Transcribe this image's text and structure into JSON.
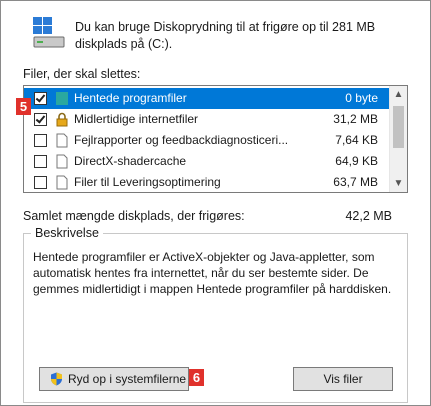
{
  "header": {
    "line1": "Du kan bruge Diskoprydning til at frigøre op til 281 MB",
    "line2": "diskplads på  (C:).",
    "icon": "disk-cleanup-icon"
  },
  "files_label": "Filer, der skal slettes:",
  "files": [
    {
      "name": "Hentede programfiler",
      "size": "0 byte",
      "checked": true,
      "selected": true,
      "icon": "folder-teal-icon"
    },
    {
      "name": "Midlertidige internetfiler",
      "size": "31,2 MB",
      "checked": true,
      "selected": false,
      "icon": "lock-icon"
    },
    {
      "name": "Fejlrapporter og feedbackdiagnosticeri...",
      "size": "7,64 KB",
      "checked": false,
      "selected": false,
      "icon": "file-icon"
    },
    {
      "name": "DirectX-shadercache",
      "size": "64,9 KB",
      "checked": false,
      "selected": false,
      "icon": "file-icon"
    },
    {
      "name": "Filer til Leveringsoptimering",
      "size": "63,7 MB",
      "checked": false,
      "selected": false,
      "icon": "file-icon"
    }
  ],
  "total_label": "Samlet mængde diskplads, der frigøres:",
  "total_value": "42,2 MB",
  "description": {
    "title": "Beskrivelse",
    "text": "Hentede programfiler er ActiveX-objekter og Java-appletter, som automatisk hentes fra internettet, når du ser bestemte sider. De gemmes midlertidigt i mappen Hentede programfiler på harddisken."
  },
  "buttons": {
    "clean_system": "Ryd op i systemfilerne",
    "view_files": "Vis filer"
  },
  "callouts": {
    "list": "5",
    "button": "6"
  },
  "colors": {
    "selection": "#0078d7",
    "callout": "#e0312b"
  }
}
